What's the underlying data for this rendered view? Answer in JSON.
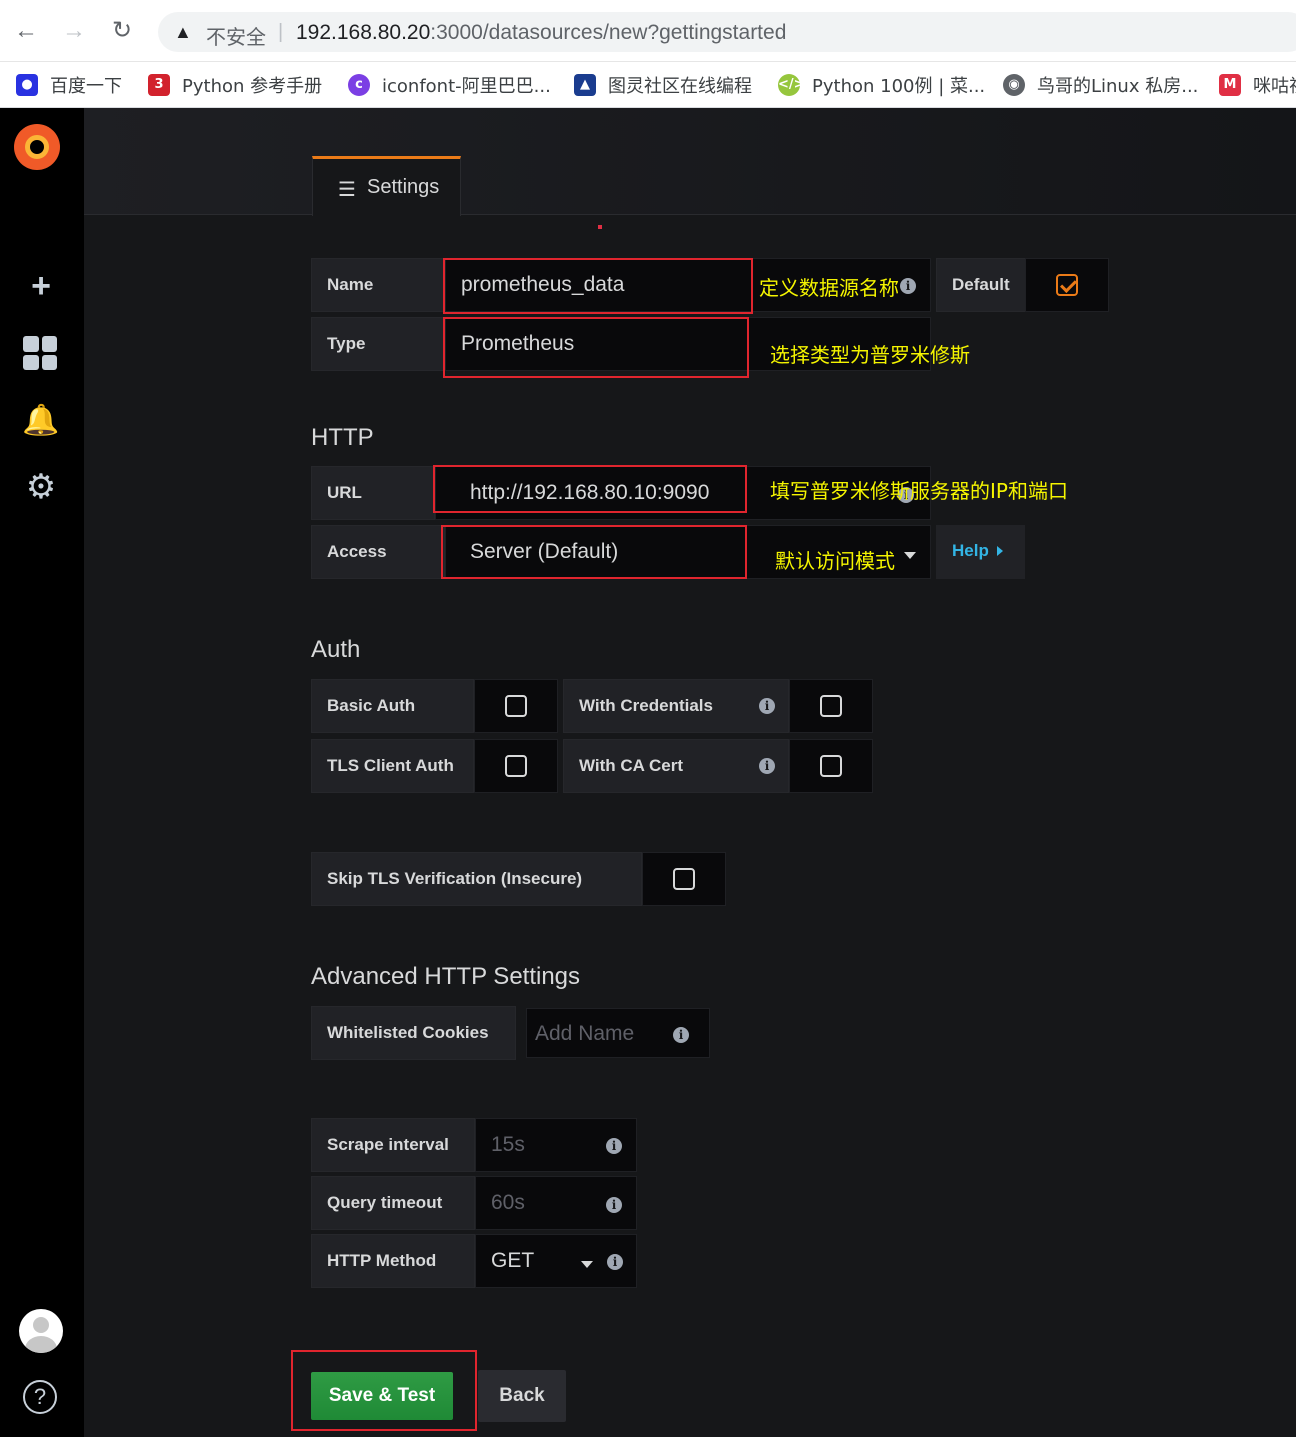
{
  "browser": {
    "insecure_label": "不安全",
    "url_host": "192.168.80.20",
    "url_path": ":3000/datasources/new?gettingstarted",
    "bookmarks": [
      {
        "label": "百度一下",
        "icon": "baidu-icon",
        "color": "#2932e1"
      },
      {
        "label": "Python 参考手册",
        "icon": "python-ref-icon",
        "color": "#d2222d"
      },
      {
        "label": "iconfont-阿里巴巴...",
        "icon": "iconfont-icon",
        "color": "#7b3fe4"
      },
      {
        "label": "图灵社区在线编程",
        "icon": "turing-icon",
        "color": "#1a3c8f"
      },
      {
        "label": "Python 100例 | 菜...",
        "icon": "runoob-icon",
        "color": "#96c63d"
      },
      {
        "label": "鸟哥的Linux 私房...",
        "icon": "globe-icon",
        "color": "#5f6368"
      },
      {
        "label": "咪咕视",
        "icon": "migu-icon",
        "color": "#e02f44"
      }
    ]
  },
  "header": {
    "tab_settings": "Settings"
  },
  "form": {
    "name_label": "Name",
    "name_value": "prometheus_data",
    "default_label": "Default",
    "default_checked": true,
    "type_label": "Type",
    "type_value": "Prometheus",
    "http_title": "HTTP",
    "url_label": "URL",
    "url_value": "http://192.168.80.10:9090",
    "access_label": "Access",
    "access_value": "Server (Default)",
    "help_label": "Help",
    "auth_title": "Auth",
    "basic_auth_label": "Basic Auth",
    "with_credentials_label": "With Credentials",
    "tls_client_auth_label": "TLS Client Auth",
    "with_ca_cert_label": "With CA Cert",
    "skip_tls_label": "Skip TLS Verification (Insecure)",
    "advanced_title": "Advanced HTTP Settings",
    "whitelisted_cookies_label": "Whitelisted Cookies",
    "whitelisted_cookies_placeholder": "Add Name",
    "scrape_interval_label": "Scrape interval",
    "scrape_interval_placeholder": "15s",
    "query_timeout_label": "Query timeout",
    "query_timeout_placeholder": "60s",
    "http_method_label": "HTTP Method",
    "http_method_value": "GET",
    "save_button": "Save & Test",
    "back_button": "Back"
  },
  "annotations": {
    "name_note": "定义数据源名称",
    "type_note": "选择类型为普罗米修斯",
    "url_note": "填写普罗米修斯服务器的IP和端口",
    "access_note": "默认访问模式"
  },
  "colors": {
    "accent": "#eb7b18",
    "success": "#299c46",
    "link": "#33b5e5",
    "annotation_box": "#e0252e",
    "annotation_text": "#f5f500"
  }
}
